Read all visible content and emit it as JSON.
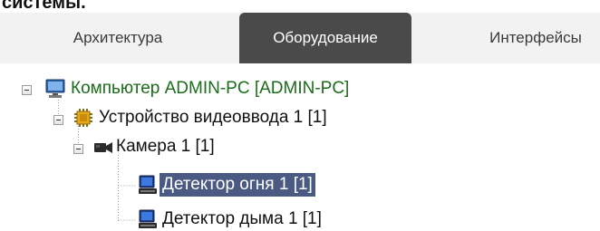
{
  "heading_fragment": "системы.",
  "tabs": [
    {
      "label": "Архитектура",
      "active": false
    },
    {
      "label": "Оборудование",
      "active": true
    },
    {
      "label": "Интерфейсы",
      "active": false
    }
  ],
  "tree": {
    "computer": {
      "label": "Компьютер ADMIN-PC [ADMIN-PC]",
      "icon": "monitor-icon",
      "expanded": true
    },
    "video_input": {
      "label": "Устройство видеоввода 1 [1]",
      "icon": "chip-icon",
      "expanded": true
    },
    "camera": {
      "label": "Камера 1 [1]",
      "icon": "camera-icon",
      "expanded": true
    },
    "fire_detector": {
      "label": "Детектор огня 1 [1]",
      "icon": "detector-icon",
      "selected": true
    },
    "smoke_detector": {
      "label": "Детектор дыма 1 [1]",
      "icon": "detector-icon",
      "selected": false
    }
  },
  "colors": {
    "active_tab": "#4a4a4a",
    "selection": "#4b5a83",
    "computer_label": "#1a6d1a"
  }
}
